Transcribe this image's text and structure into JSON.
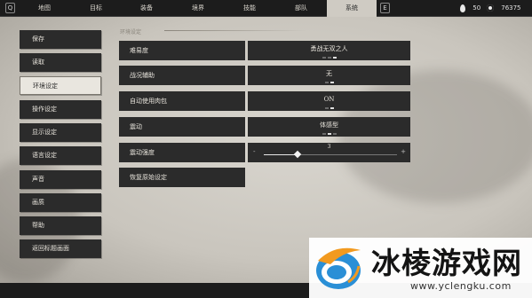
{
  "topbar": {
    "left_key": "Q",
    "right_key": "E",
    "tabs": [
      {
        "label": "地图"
      },
      {
        "label": "目标"
      },
      {
        "label": "装备"
      },
      {
        "label": "境界"
      },
      {
        "label": "技能"
      },
      {
        "label": "部队"
      },
      {
        "label": "系统"
      }
    ],
    "active_tab": "系统",
    "resources": [
      {
        "icon": "jade-icon",
        "value": "50"
      },
      {
        "icon": "coin-icon",
        "value": "76375"
      }
    ]
  },
  "sidebar": {
    "items": [
      {
        "label": "保存"
      },
      {
        "label": "读取"
      },
      {
        "label": "环境设定"
      },
      {
        "label": "操作设定"
      },
      {
        "label": "显示设定"
      },
      {
        "label": "语言设定"
      },
      {
        "label": "声音"
      },
      {
        "label": "画质"
      },
      {
        "label": "帮助"
      },
      {
        "label": "返回标题画面"
      }
    ],
    "active": "环境设定"
  },
  "section": {
    "title": "环境设定"
  },
  "settings": [
    {
      "label": "难易度",
      "value": "勇战无双之人",
      "options_count": 3,
      "selected_index": 2
    },
    {
      "label": "战况辅助",
      "value": "无",
      "options_count": 2,
      "selected_index": 1
    },
    {
      "label": "自动使用肉包",
      "value": "ON",
      "options_count": 2,
      "selected_index": 1
    },
    {
      "label": "震动",
      "value": "体感型",
      "options_count": 3,
      "selected_index": 1
    },
    {
      "label": "震动强度",
      "value": "3",
      "slider": {
        "minus": "-",
        "plus": "+",
        "level": 0.25
      }
    }
  ],
  "reset_button": {
    "label": "恢复原始设定"
  },
  "watermark": {
    "title": "冰棱游戏网",
    "url": "www.yclengku.com",
    "colors": {
      "blue": "#2a8fd6",
      "orange": "#f29a1f"
    }
  },
  "colors": {
    "panel_bg": "#d2cec7",
    "button_dark": "#2b2b2b",
    "active_light": "#e9e6df"
  }
}
